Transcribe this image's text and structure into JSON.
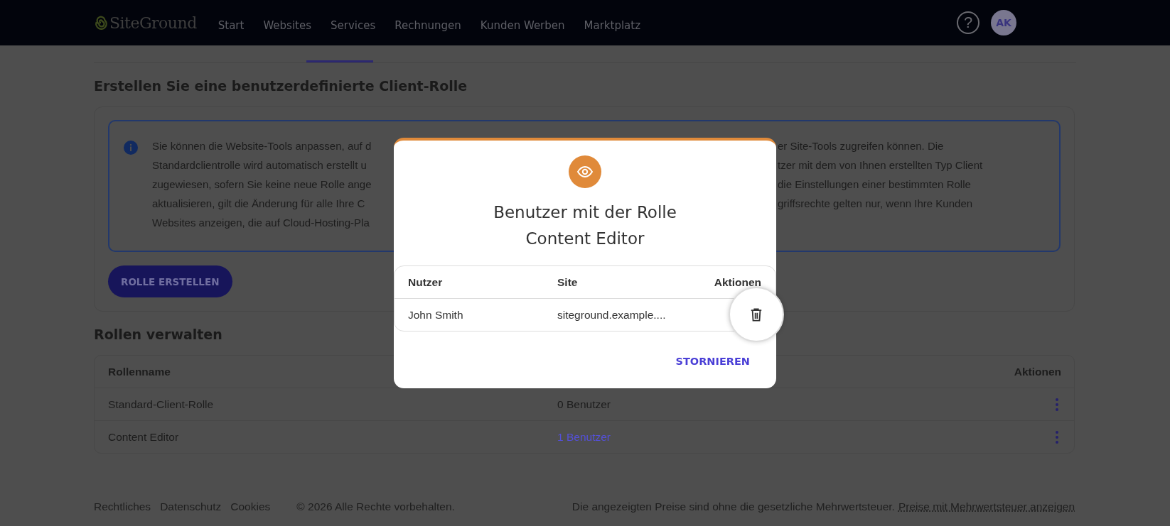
{
  "header": {
    "logo": "SiteGround",
    "nav": [
      {
        "label": "Start"
      },
      {
        "label": "Websites"
      },
      {
        "label": "Services"
      },
      {
        "label": "Rechnungen"
      },
      {
        "label": "Kunden Werben"
      },
      {
        "label": "Marktplatz"
      }
    ],
    "help": "?",
    "avatar": "AK"
  },
  "section_title": "Erstellen Sie eine benutzerdefinierte Client-Rolle",
  "info": {
    "lines": [
      {
        "left": "Sie können die Website-Tools anpassen, auf d",
        "right": "er Site-Tools zugreifen können. Die"
      },
      {
        "left": "Standardclientrolle wird automatisch erstellt u",
        "right": "tzer mit dem von Ihnen erstellten Typ Client"
      },
      {
        "left": "zugewiesen, sofern Sie keine neue Rolle ange",
        "right": "die Einstellungen einer bestimmten Rolle"
      },
      {
        "left": "aktualisieren, gilt die Änderung für alle Ihre C",
        "right": "griffsrechte gelten nur, wenn Ihre Kunden"
      },
      {
        "left": "Websites anzeigen, die auf Cloud-Hosting-Pla"
      }
    ]
  },
  "create_button": "ROLLE ERSTELLEN",
  "roles_title": "Rollen verwalten",
  "roles_table": {
    "columns": [
      "Rollenname",
      "Aktionen"
    ],
    "rows": [
      {
        "name": "Standard-Client-Rolle",
        "users": "0 Benutzer",
        "link": false
      },
      {
        "name": "Content Editor",
        "users": "1 Benutzer",
        "link": true
      }
    ]
  },
  "footer": {
    "links": [
      "Rechtliches",
      "Datenschutz",
      "Cookies"
    ],
    "copyright": "© 2026 Alle Rechte vorbehalten.",
    "note": "Die angezeigten Preise sind ohne die gesetzliche Mehrwertsteuer.",
    "note_link": "Preise mit Mehrwertsteuer anzeigen"
  },
  "dialog": {
    "title_lines": [
      "Benutzer mit der Rolle",
      "Content Editor"
    ],
    "columns": [
      "Nutzer",
      "Site",
      "Aktionen"
    ],
    "rows": [
      {
        "user": "John Smith",
        "site": "siteground.example...."
      }
    ],
    "cancel": "STORNIEREN"
  }
}
